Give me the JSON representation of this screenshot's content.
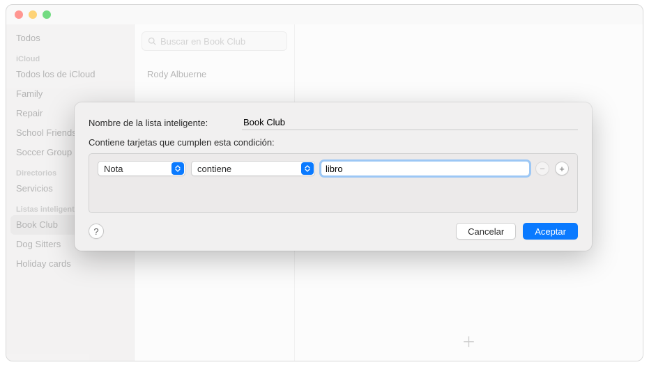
{
  "sidebar": {
    "all_label": "Todos",
    "sections": [
      {
        "header": "iCloud",
        "items": [
          "Todos los de iCloud",
          "Family",
          "Repair",
          "School Friends",
          "Soccer Group"
        ]
      },
      {
        "header": "Directorios",
        "items": [
          "Servicios"
        ]
      },
      {
        "header": "Listas inteligentes",
        "items": [
          "Book Club",
          "Dog Sitters",
          "Holiday cards"
        ]
      }
    ],
    "selected": "Book Club"
  },
  "search": {
    "placeholder": "Buscar en Book Club"
  },
  "contacts": [
    {
      "name": "Rody Albuerne"
    }
  ],
  "sheet": {
    "name_label": "Nombre de la lista inteligente:",
    "name_value": "Book Club",
    "condition_header": "Contiene tarjetas que cumplen esta condición:",
    "field_value": "Nota",
    "operator_value": "contiene",
    "value_value": "libro",
    "cancel_label": "Cancelar",
    "accept_label": "Aceptar",
    "help_label": "?",
    "minus_label": "−",
    "plus_label": "+"
  }
}
